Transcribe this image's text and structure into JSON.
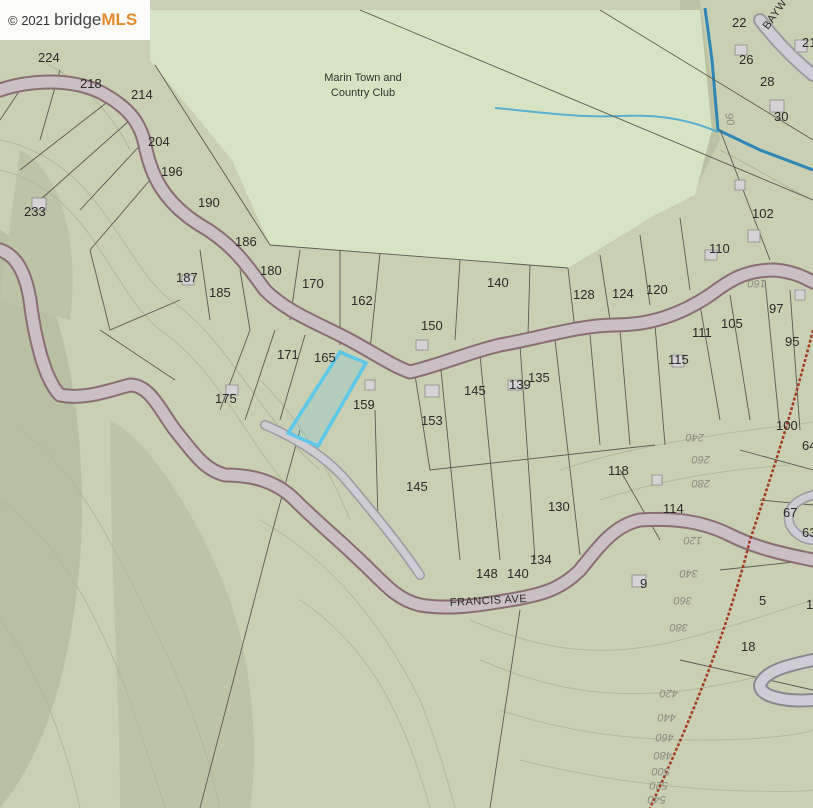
{
  "watermark": {
    "copyright": "© 2021",
    "brand": "bridge",
    "brand_accent": "MLS"
  },
  "place_labels": [
    {
      "text": "Marin Town and"
    },
    {
      "text": "Country Club"
    }
  ],
  "street_labels": [
    {
      "text": "FRANCIS AVE"
    },
    {
      "text": "BAYW"
    }
  ],
  "lots": [
    "224",
    "218",
    "214",
    "204",
    "196",
    "190",
    "186",
    "233",
    "187",
    "185",
    "180",
    "170",
    "162",
    "140",
    "128",
    "124",
    "120",
    "110",
    "102",
    "22",
    "26",
    "28",
    "30",
    "21",
    "150",
    "171",
    "165",
    "175",
    "159",
    "153",
    "145",
    "139",
    "135",
    "115",
    "111",
    "105",
    "97",
    "95",
    "100",
    "64",
    "118",
    "114",
    "67",
    "63",
    "130",
    "134",
    "148",
    "140",
    "145",
    "9",
    "5",
    "18"
  ],
  "contours": [
    "240",
    "260",
    "280",
    "120",
    "340",
    "360",
    "380",
    "420",
    "440",
    "460",
    "480",
    "500",
    "520",
    "540",
    "160",
    "90"
  ],
  "colors": {
    "club_green": "#d7e4c3",
    "terrain": "#c9cfb2",
    "road_fill": "#c9c5cc",
    "road_edge": "#8a6e72",
    "highlight": "#5ec8e8",
    "creek": "#2f86b5",
    "trail": "#a23b22"
  }
}
